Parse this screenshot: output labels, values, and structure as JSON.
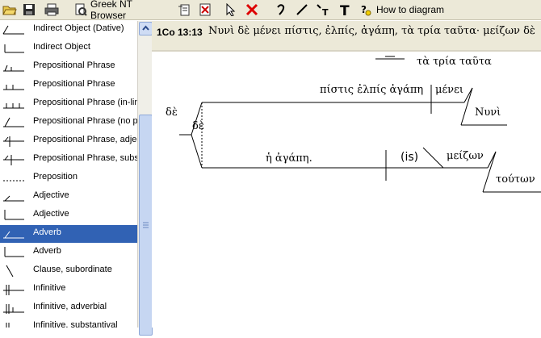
{
  "toolbar": {
    "greek_nt_browser_label": "Greek NT Browser",
    "how_to_diagram_label": "How to diagram"
  },
  "sidebar": {
    "items": [
      {
        "label": "Indirect Object (Dative)",
        "icon": "indirect-object-dative-icon"
      },
      {
        "label": "Indirect Object",
        "icon": "indirect-object-icon"
      },
      {
        "label": "Prepositional Phrase",
        "icon": "prep-phrase-icon"
      },
      {
        "label": "Prepositional Phrase",
        "icon": "prep-phrase-icon"
      },
      {
        "label": "Prepositional Phrase (in-lin",
        "icon": "prep-phrase-inline-icon"
      },
      {
        "label": "Prepositional Phrase (no pr",
        "icon": "prep-phrase-no-prep-icon"
      },
      {
        "label": "Prepositional Phrase, adjec",
        "icon": "prep-phrase-adj-icon"
      },
      {
        "label": "Prepositional Phrase, subs",
        "icon": "prep-phrase-subs-icon"
      },
      {
        "label": "Preposition",
        "icon": "preposition-dotted-icon"
      },
      {
        "label": "Adjective",
        "icon": "adjective-icon"
      },
      {
        "label": "Adjective",
        "icon": "adjective-icon"
      },
      {
        "label": "Adverb",
        "icon": "adverb-icon"
      },
      {
        "label": "Adverb",
        "icon": "adverb-icon"
      },
      {
        "label": "Clause, subordinate",
        "icon": "clause-subordinate-icon"
      },
      {
        "label": "Infinitive",
        "icon": "infinitive-icon"
      },
      {
        "label": "Infinitive, adverbial",
        "icon": "infinitive-adverbial-icon"
      },
      {
        "label": "Infinitive, substantival",
        "icon": "infinitive-substantival-icon"
      }
    ],
    "selected_index": 11,
    "selected_color": "#3162b4"
  },
  "verse": {
    "reference": "1Co 13:13",
    "text": "Νυνὶ δὲ μένει πίστις, ἐλπίς, ἀγάπη, τὰ τρία ταῦτα· μείζων δὲ"
  },
  "diagram": {
    "top_modifier": "τὰ τρία ταῦτα",
    "compound_subject": "πίστις ἐλπίς ἀγάπη",
    "verb_1": "μένει",
    "adverb_1": "Νυνὶ",
    "conjunction_outer": "δὲ",
    "conjunction_inner": "δὲ",
    "subject_2": "ἡ ἀγάπη.",
    "verb_2": "(is)",
    "predicate_adj": "μείζων",
    "genitive": "τούτων"
  }
}
